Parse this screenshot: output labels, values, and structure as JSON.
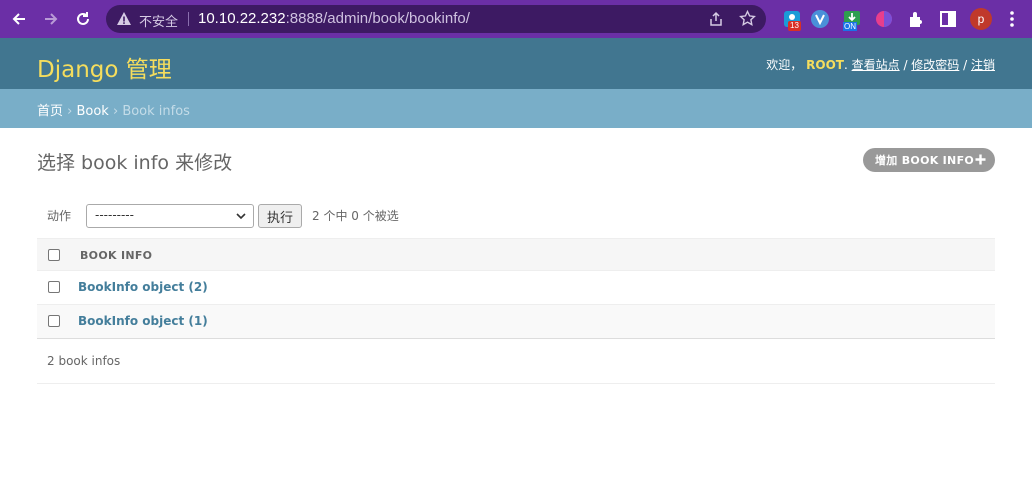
{
  "browser": {
    "security_label": "不安全",
    "url_host": "10.10.22.232",
    "url_rest": ":8888/admin/book/bookinfo/",
    "ext_badge": "13",
    "ext_on": "ON",
    "avatar_letter": "p"
  },
  "header": {
    "branding": "Django 管理",
    "welcome": "欢迎，",
    "username": "ROOT",
    "view_site": "查看站点",
    "change_password": "修改密码",
    "logout": "注销",
    "sep": " / "
  },
  "breadcrumbs": {
    "home": "首页",
    "app": "Book",
    "current": "Book infos",
    "sep": " › "
  },
  "content": {
    "title": "选择 book info 来修改",
    "add_label": "增加 BOOK INFO"
  },
  "actions": {
    "label": "动作",
    "selected": "---------",
    "go_label": "执行",
    "counter": "2 个中 0 个被选"
  },
  "table": {
    "column": "BOOK INFO",
    "rows": [
      {
        "label": "BookInfo object (2)"
      },
      {
        "label": "BookInfo object (1)"
      }
    ]
  },
  "paginator": {
    "text": "2 book infos"
  },
  "colors": {
    "chrome": "#6b2fa6",
    "header": "#417690",
    "breadcrumbs": "#79aec8",
    "branding": "#f5dd5d",
    "link": "#447e9b"
  }
}
